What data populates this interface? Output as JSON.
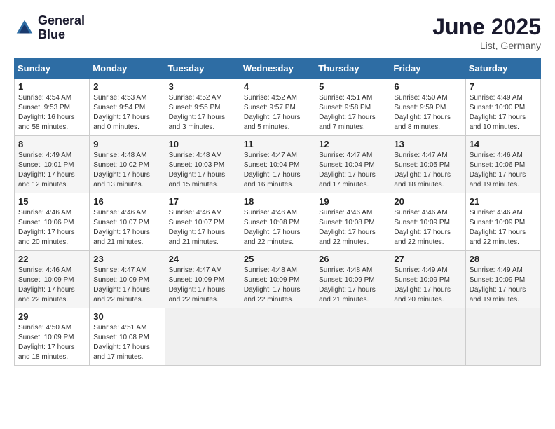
{
  "header": {
    "logo_line1": "General",
    "logo_line2": "Blue",
    "month": "June 2025",
    "location": "List, Germany"
  },
  "days_of_week": [
    "Sunday",
    "Monday",
    "Tuesday",
    "Wednesday",
    "Thursday",
    "Friday",
    "Saturday"
  ],
  "weeks": [
    [
      {
        "day": "1",
        "sunrise": "4:54 AM",
        "sunset": "9:53 PM",
        "daylight": "16 hours and 58 minutes."
      },
      {
        "day": "2",
        "sunrise": "4:53 AM",
        "sunset": "9:54 PM",
        "daylight": "17 hours and 0 minutes."
      },
      {
        "day": "3",
        "sunrise": "4:52 AM",
        "sunset": "9:55 PM",
        "daylight": "17 hours and 3 minutes."
      },
      {
        "day": "4",
        "sunrise": "4:52 AM",
        "sunset": "9:57 PM",
        "daylight": "17 hours and 5 minutes."
      },
      {
        "day": "5",
        "sunrise": "4:51 AM",
        "sunset": "9:58 PM",
        "daylight": "17 hours and 7 minutes."
      },
      {
        "day": "6",
        "sunrise": "4:50 AM",
        "sunset": "9:59 PM",
        "daylight": "17 hours and 8 minutes."
      },
      {
        "day": "7",
        "sunrise": "4:49 AM",
        "sunset": "10:00 PM",
        "daylight": "17 hours and 10 minutes."
      }
    ],
    [
      {
        "day": "8",
        "sunrise": "4:49 AM",
        "sunset": "10:01 PM",
        "daylight": "17 hours and 12 minutes."
      },
      {
        "day": "9",
        "sunrise": "4:48 AM",
        "sunset": "10:02 PM",
        "daylight": "17 hours and 13 minutes."
      },
      {
        "day": "10",
        "sunrise": "4:48 AM",
        "sunset": "10:03 PM",
        "daylight": "17 hours and 15 minutes."
      },
      {
        "day": "11",
        "sunrise": "4:47 AM",
        "sunset": "10:04 PM",
        "daylight": "17 hours and 16 minutes."
      },
      {
        "day": "12",
        "sunrise": "4:47 AM",
        "sunset": "10:04 PM",
        "daylight": "17 hours and 17 minutes."
      },
      {
        "day": "13",
        "sunrise": "4:47 AM",
        "sunset": "10:05 PM",
        "daylight": "17 hours and 18 minutes."
      },
      {
        "day": "14",
        "sunrise": "4:46 AM",
        "sunset": "10:06 PM",
        "daylight": "17 hours and 19 minutes."
      }
    ],
    [
      {
        "day": "15",
        "sunrise": "4:46 AM",
        "sunset": "10:06 PM",
        "daylight": "17 hours and 20 minutes."
      },
      {
        "day": "16",
        "sunrise": "4:46 AM",
        "sunset": "10:07 PM",
        "daylight": "17 hours and 21 minutes."
      },
      {
        "day": "17",
        "sunrise": "4:46 AM",
        "sunset": "10:07 PM",
        "daylight": "17 hours and 21 minutes."
      },
      {
        "day": "18",
        "sunrise": "4:46 AM",
        "sunset": "10:08 PM",
        "daylight": "17 hours and 22 minutes."
      },
      {
        "day": "19",
        "sunrise": "4:46 AM",
        "sunset": "10:08 PM",
        "daylight": "17 hours and 22 minutes."
      },
      {
        "day": "20",
        "sunrise": "4:46 AM",
        "sunset": "10:09 PM",
        "daylight": "17 hours and 22 minutes."
      },
      {
        "day": "21",
        "sunrise": "4:46 AM",
        "sunset": "10:09 PM",
        "daylight": "17 hours and 22 minutes."
      }
    ],
    [
      {
        "day": "22",
        "sunrise": "4:46 AM",
        "sunset": "10:09 PM",
        "daylight": "17 hours and 22 minutes."
      },
      {
        "day": "23",
        "sunrise": "4:47 AM",
        "sunset": "10:09 PM",
        "daylight": "17 hours and 22 minutes."
      },
      {
        "day": "24",
        "sunrise": "4:47 AM",
        "sunset": "10:09 PM",
        "daylight": "17 hours and 22 minutes."
      },
      {
        "day": "25",
        "sunrise": "4:48 AM",
        "sunset": "10:09 PM",
        "daylight": "17 hours and 22 minutes."
      },
      {
        "day": "26",
        "sunrise": "4:48 AM",
        "sunset": "10:09 PM",
        "daylight": "17 hours and 21 minutes."
      },
      {
        "day": "27",
        "sunrise": "4:49 AM",
        "sunset": "10:09 PM",
        "daylight": "17 hours and 20 minutes."
      },
      {
        "day": "28",
        "sunrise": "4:49 AM",
        "sunset": "10:09 PM",
        "daylight": "17 hours and 19 minutes."
      }
    ],
    [
      {
        "day": "29",
        "sunrise": "4:50 AM",
        "sunset": "10:09 PM",
        "daylight": "17 hours and 18 minutes."
      },
      {
        "day": "30",
        "sunrise": "4:51 AM",
        "sunset": "10:08 PM",
        "daylight": "17 hours and 17 minutes."
      },
      null,
      null,
      null,
      null,
      null
    ]
  ],
  "labels": {
    "sunrise": "Sunrise: ",
    "sunset": "Sunset: ",
    "daylight": "Daylight: "
  }
}
